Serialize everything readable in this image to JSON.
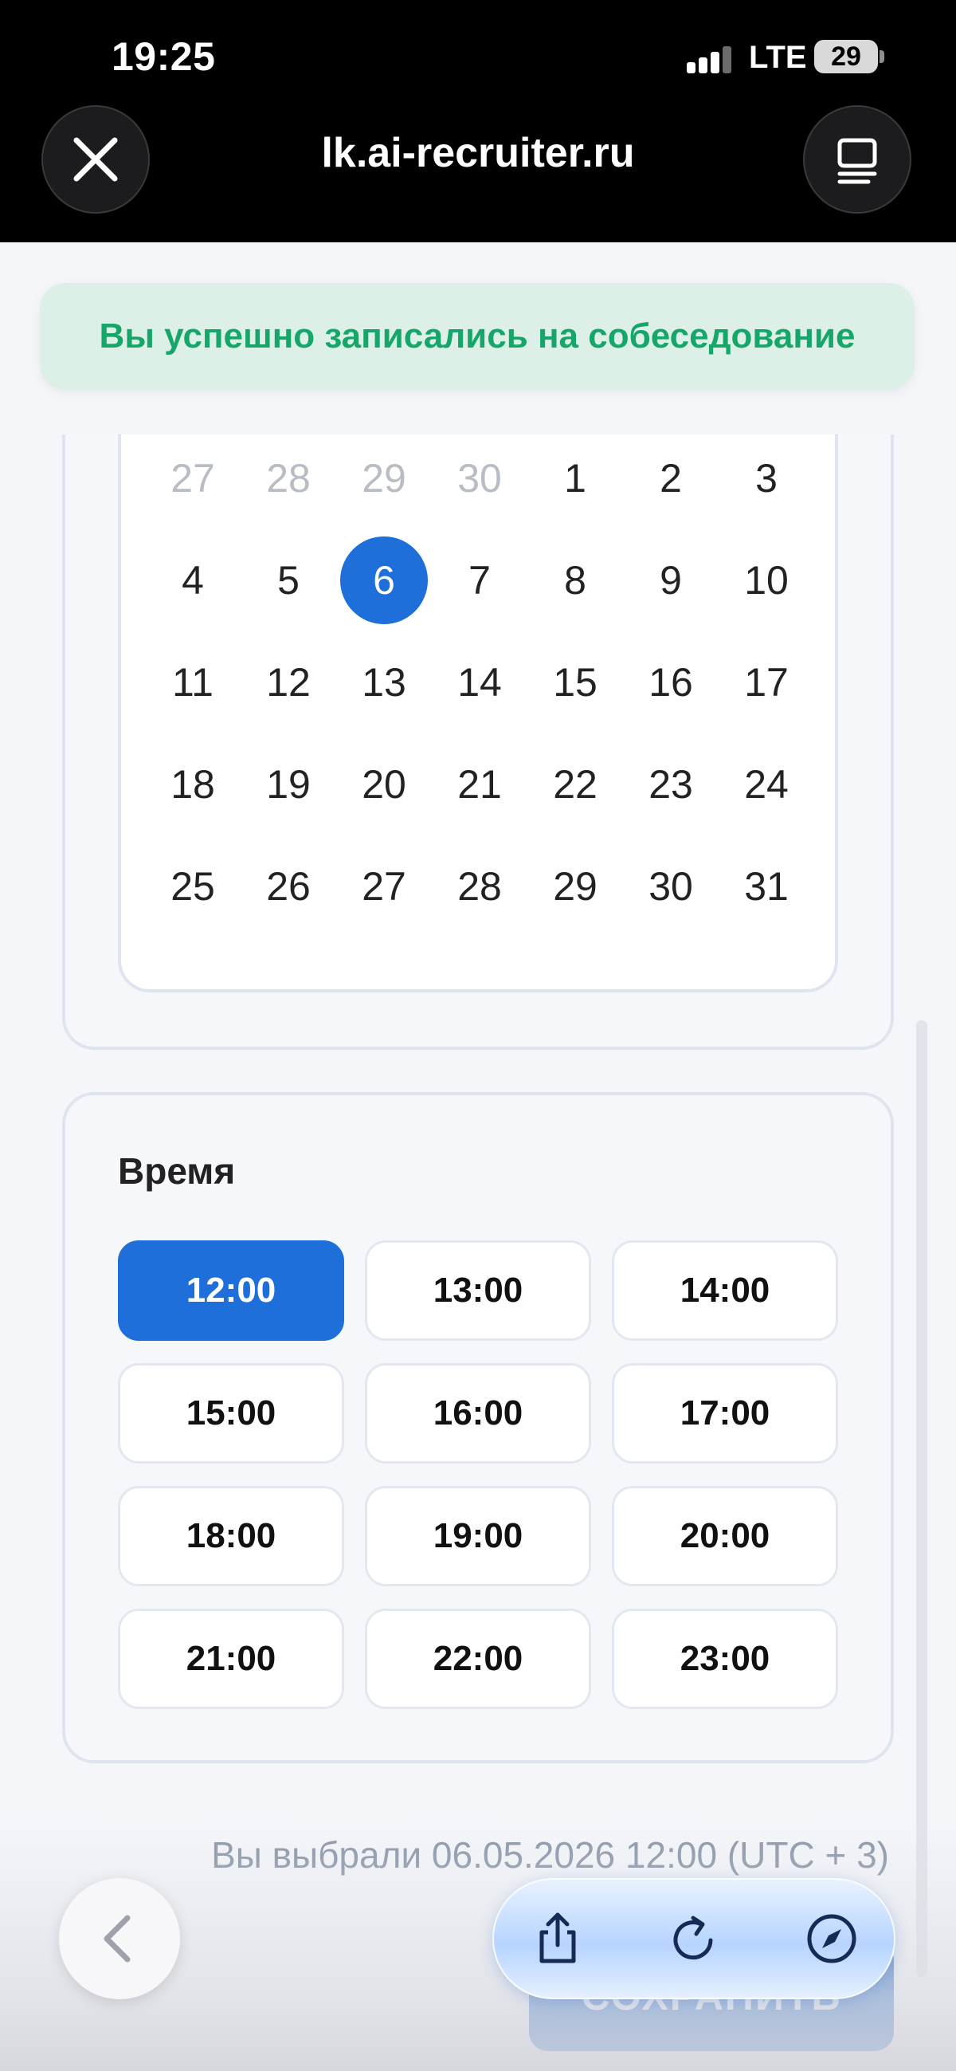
{
  "status_bar": {
    "time": "19:25",
    "network": "LTE",
    "battery": "29"
  },
  "browser": {
    "url": "lk.ai-recruiter.ru",
    "close_icon": "close-icon",
    "tabs_icon": "tabs-icon"
  },
  "toast": {
    "message": "Вы успешно записались на собеседование"
  },
  "calendar": {
    "weeks": [
      [
        "27",
        "28",
        "29",
        "30",
        "1",
        "2",
        "3"
      ],
      [
        "4",
        "5",
        "6",
        "7",
        "8",
        "9",
        "10"
      ],
      [
        "11",
        "12",
        "13",
        "14",
        "15",
        "16",
        "17"
      ],
      [
        "18",
        "19",
        "20",
        "21",
        "22",
        "23",
        "24"
      ],
      [
        "25",
        "26",
        "27",
        "28",
        "29",
        "30",
        "31"
      ]
    ],
    "muted_days": [
      "27",
      "28",
      "29",
      "30"
    ],
    "selected_day": "6"
  },
  "time": {
    "heading": "Время",
    "slots": [
      "12:00",
      "13:00",
      "14:00",
      "15:00",
      "16:00",
      "17:00",
      "18:00",
      "19:00",
      "20:00",
      "21:00",
      "22:00",
      "23:00"
    ],
    "selected": "12:00"
  },
  "selection_text": "Вы выбрали 06.05.2026 12:00 (UTC + 3)",
  "save_button": "СОХРАНИТЬ",
  "toolbar": {
    "back_icon": "chevron-left-icon",
    "share_icon": "share-icon",
    "reload_icon": "reload-icon",
    "compass_icon": "compass-icon"
  },
  "colors": {
    "accent": "#1e6fd9",
    "success_text": "#16a66a",
    "success_bg": "#ddf0e8"
  }
}
